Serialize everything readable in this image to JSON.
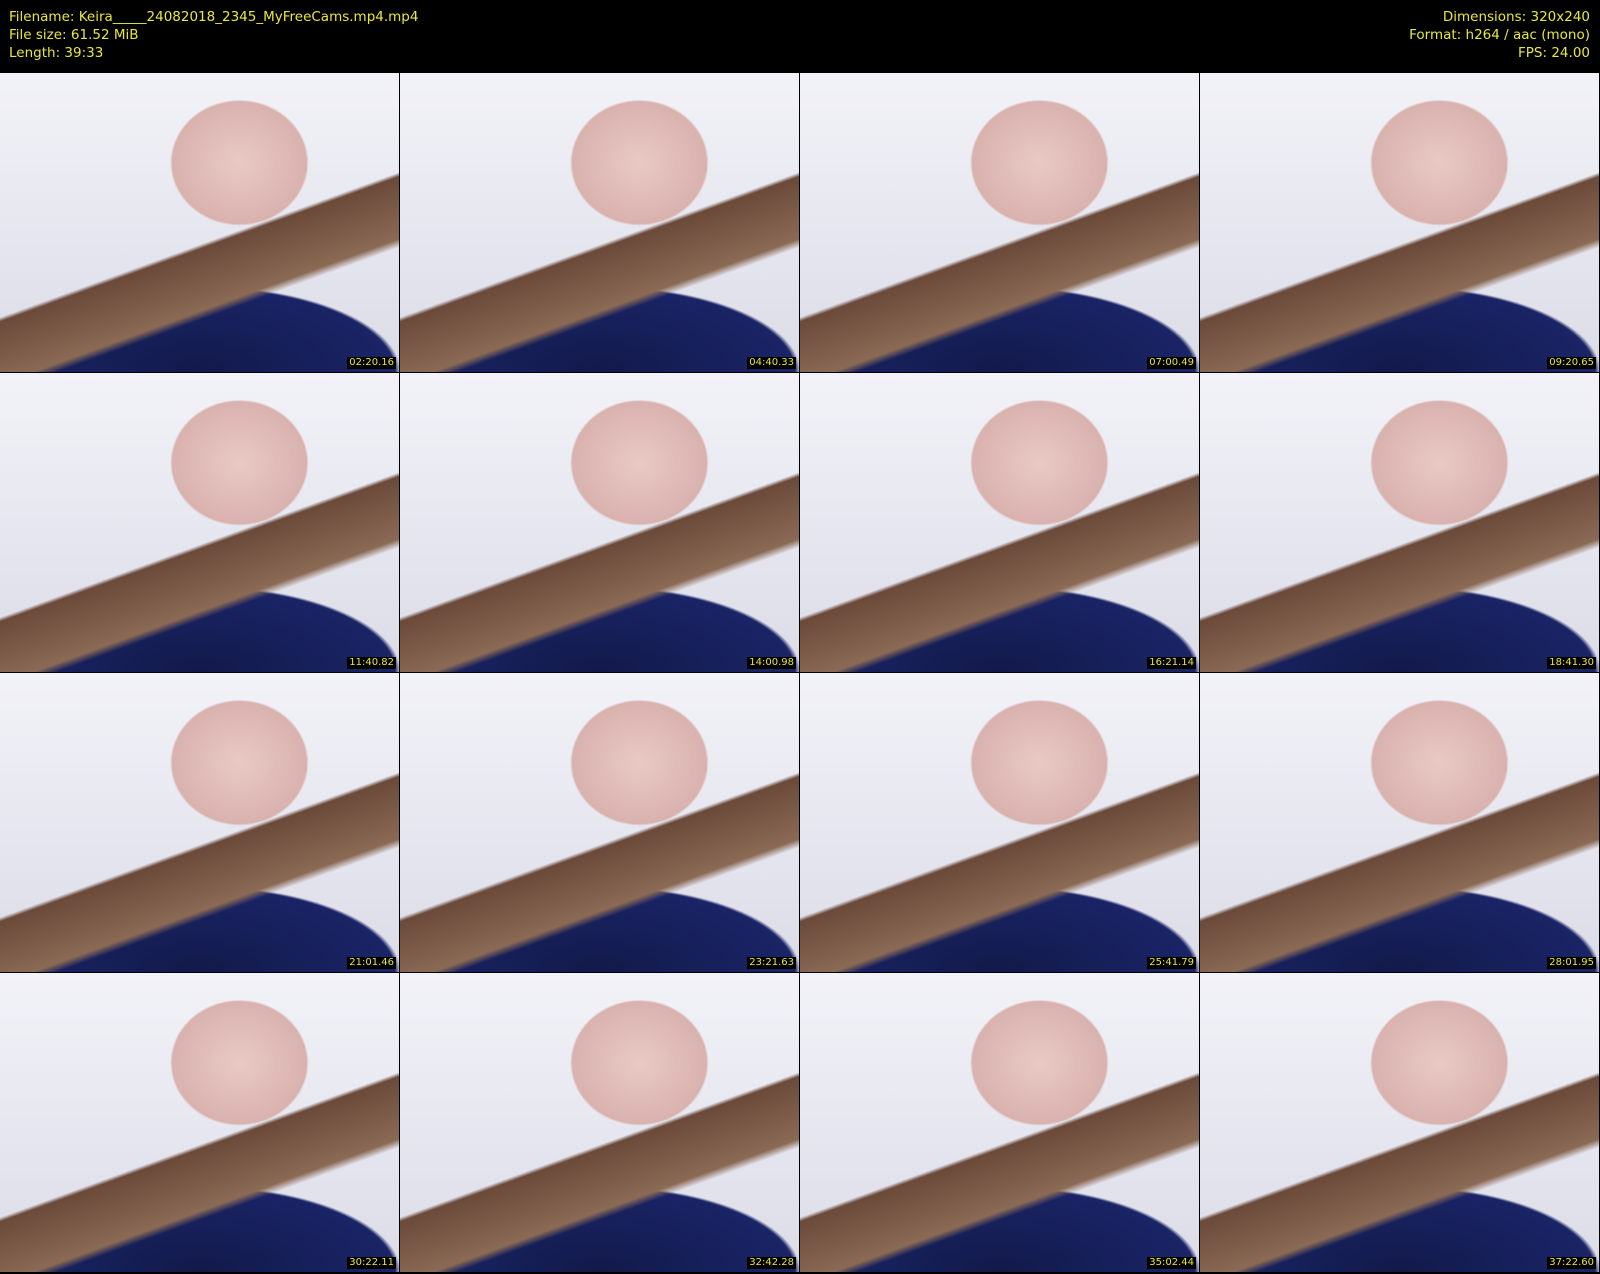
{
  "header": {
    "filename": "Filename: Keira_____24082018_2345_MyFreeCams.mp4.mp4",
    "filesize": "File size: 61.52 MiB",
    "length": "Length: 39:33",
    "dimensions": "Dimensions: 320x240",
    "format": "Format: h264 / aac (mono)",
    "fps": "FPS: 24.00"
  },
  "thumbnails": [
    {
      "time": "02:20.16"
    },
    {
      "time": "04:40.33"
    },
    {
      "time": "07:00.49"
    },
    {
      "time": "09:20.65"
    },
    {
      "time": "11:40.82"
    },
    {
      "time": "14:00.98"
    },
    {
      "time": "16:21.14"
    },
    {
      "time": "18:41.30"
    },
    {
      "time": "21:01.46"
    },
    {
      "time": "23:21.63"
    },
    {
      "time": "25:41.79"
    },
    {
      "time": "28:01.95"
    },
    {
      "time": "30:22.11"
    },
    {
      "time": "32:42.28"
    },
    {
      "time": "35:02.44"
    },
    {
      "time": "37:22.60"
    }
  ]
}
